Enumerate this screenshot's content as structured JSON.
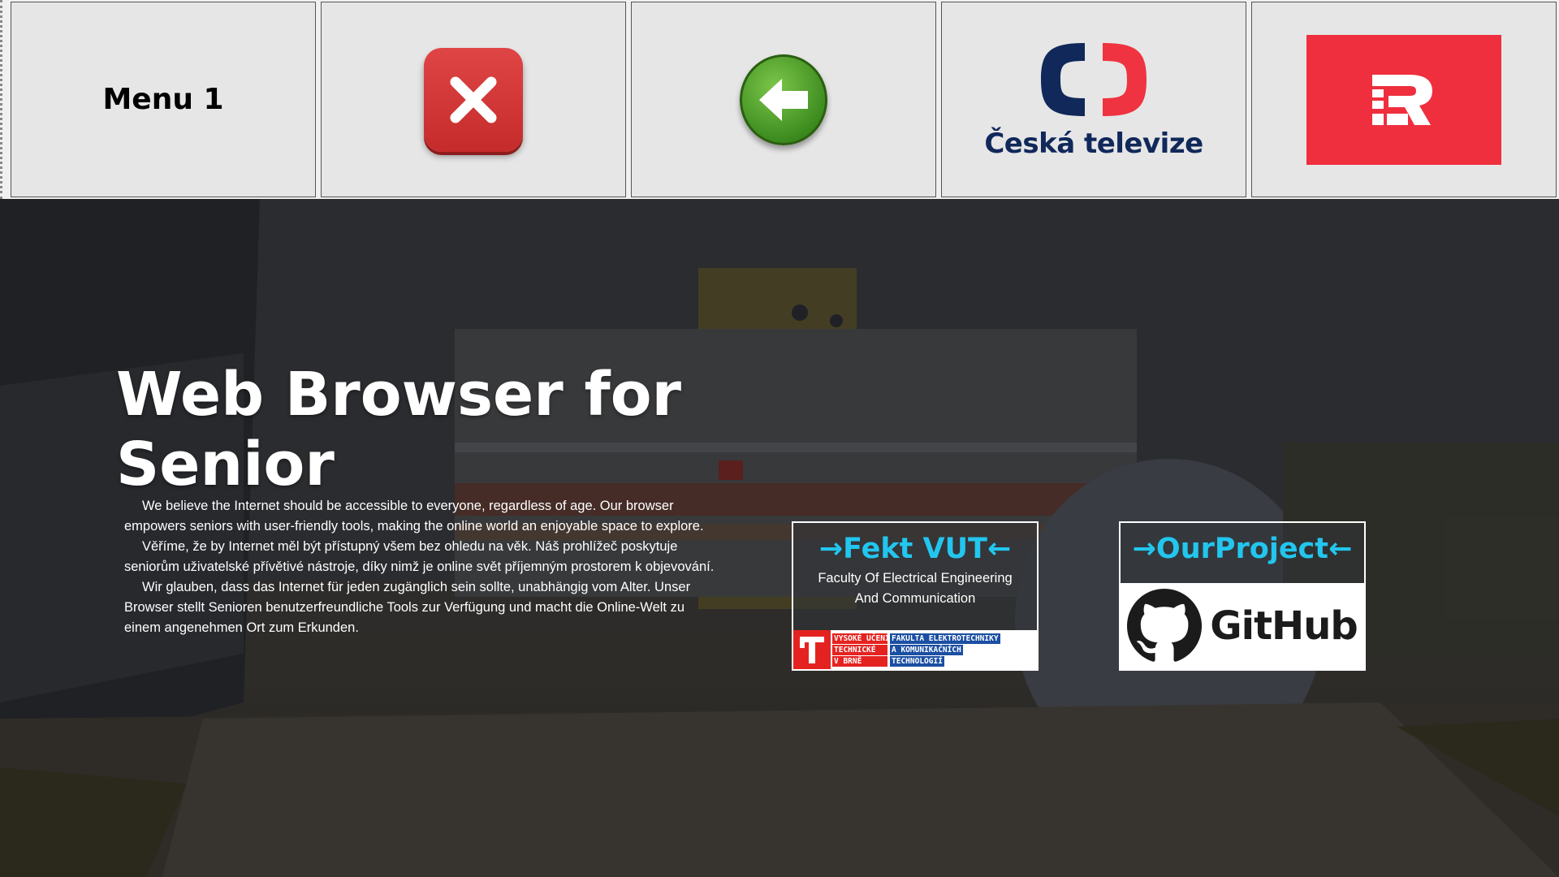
{
  "topbar": {
    "menu_label": "Menu 1",
    "close_button_icon": "close-x-icon",
    "back_button_icon": "arrow-left-icon",
    "ct_logo_text": "Česká televize",
    "rozhlas_logo_icon": "cesky-rozhlas-logo"
  },
  "hero": {
    "title": "Web Browser for Senior",
    "paragraph_en": "We believe the Internet should be accessible to everyone, regardless of age. Our browser empowers seniors with user-friendly tools, making the online world an enjoyable space to explore.",
    "paragraph_cz": "Věříme, že by Internet měl být přístupný všem bez ohledu na věk. Náš prohlížeč poskytuje seniorům uživatelské přívětivé nástroje, díky nimž je online svět příjemným prostorem k objevování.",
    "paragraph_de": "Wir glauben, dass das Internet für jeden zugänglich sein sollte, unabhängig vom Alter. Unser Browser stellt Senioren benutzerfreundliche Tools zur Verfügung und macht die Online-Welt zu einem angenehmen Ort zum Erkunden."
  },
  "cards": {
    "fekt": {
      "title": "→Fekt VUT←",
      "subtitle_line1": "Faculty Of Electrical Engineering",
      "subtitle_line2": "And Communication",
      "logo_row1_left": "VYSOKÉ UČENÍ",
      "logo_row1_right": "FAKULTA ELEKTROTECHNIKY",
      "logo_row2_left": "TECHNICKÉ",
      "logo_row2_right": "A KOMUNIKAČNÍCH",
      "logo_row3_left": "V BRNĚ",
      "logo_row3_right": "TECHNOLOGIÍ"
    },
    "project": {
      "title": "→OurProject←",
      "logo_text": "GitHub"
    }
  },
  "colors": {
    "accent_cyan": "#22c6ee",
    "ct_navy": "#10285a",
    "ct_red": "#ef3340",
    "rozhlas_red": "#ef2f3e"
  }
}
